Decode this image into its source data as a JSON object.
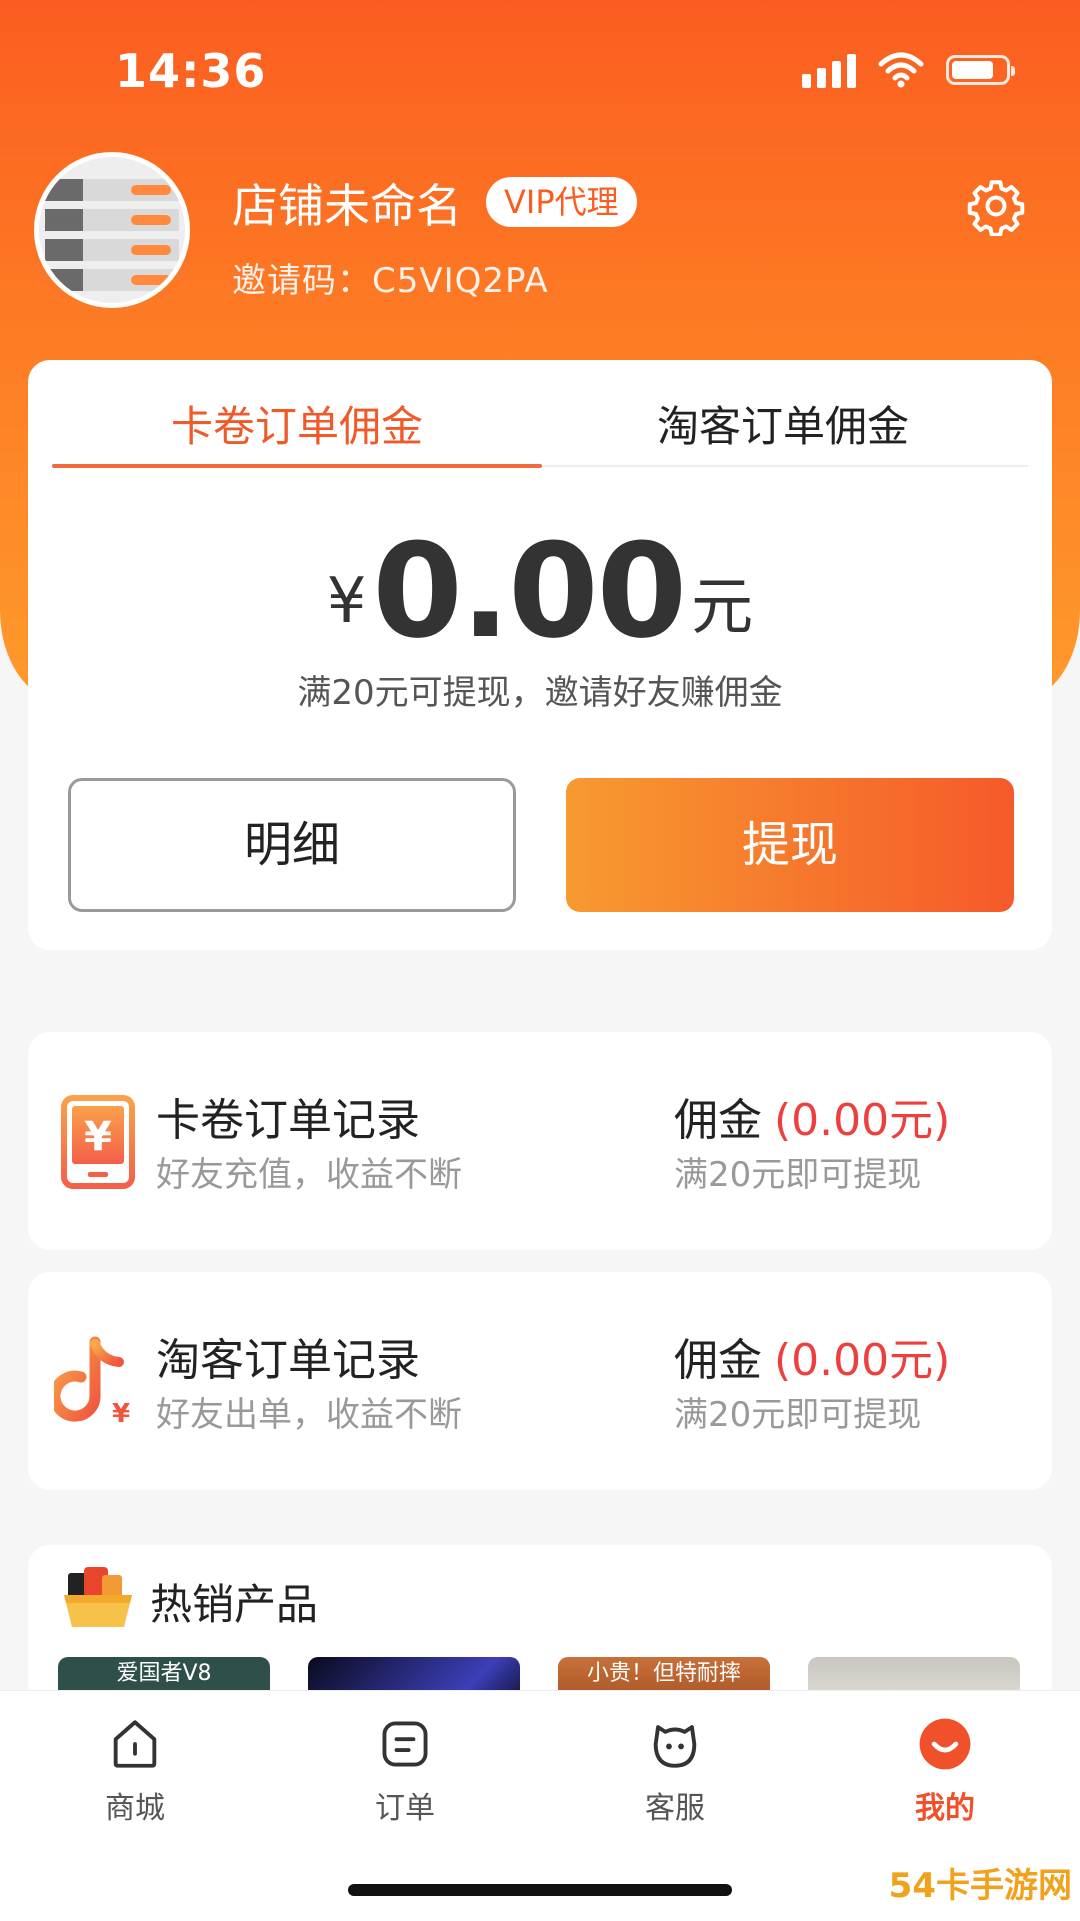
{
  "status_bar": {
    "time": "14:36"
  },
  "profile": {
    "shop_name": "店铺未命名",
    "badge": "VIP代理",
    "invite_code": "邀请码：C5VIQ2PA"
  },
  "commission": {
    "tabs": [
      {
        "label": "卡卷订单佣金",
        "active": true
      },
      {
        "label": "淘客订单佣金",
        "active": false
      }
    ],
    "currency_symbol": "¥",
    "amount": "0.00",
    "unit": "元",
    "note": "满20元可提现，邀请好友赚佣金",
    "detail_button": "明细",
    "withdraw_button": "提现"
  },
  "records": [
    {
      "title": "卡卷订单记录",
      "subtitle": "好友充值，收益不断",
      "commission_label": "佣金",
      "commission_value": "(0.00元)",
      "threshold": "满20元即可提现",
      "icon": "phone-yen-icon"
    },
    {
      "title": "淘客订单记录",
      "subtitle": "好友出单，收益不断",
      "commission_label": "佣金",
      "commission_value": "(0.00元)",
      "threshold": "满20元即可提现",
      "icon": "tiktok-yen-icon"
    }
  ],
  "hot_products": {
    "title": "热销产品",
    "items": [
      {
        "label": "爱国者V8"
      },
      {
        "label": ""
      },
      {
        "label": "小贵！但特耐摔"
      },
      {
        "label": ""
      }
    ]
  },
  "tabbar": {
    "items": [
      {
        "label": "商城",
        "icon": "home-icon",
        "active": false
      },
      {
        "label": "订单",
        "icon": "order-icon",
        "active": false
      },
      {
        "label": "客服",
        "icon": "service-icon",
        "active": false
      },
      {
        "label": "我的",
        "icon": "profile-icon",
        "active": true
      }
    ]
  },
  "watermark": "54卡手游网",
  "colors": {
    "accent": "#fb5d20",
    "value_red": "#ee3f3f",
    "active_tab": "#f0512a"
  }
}
